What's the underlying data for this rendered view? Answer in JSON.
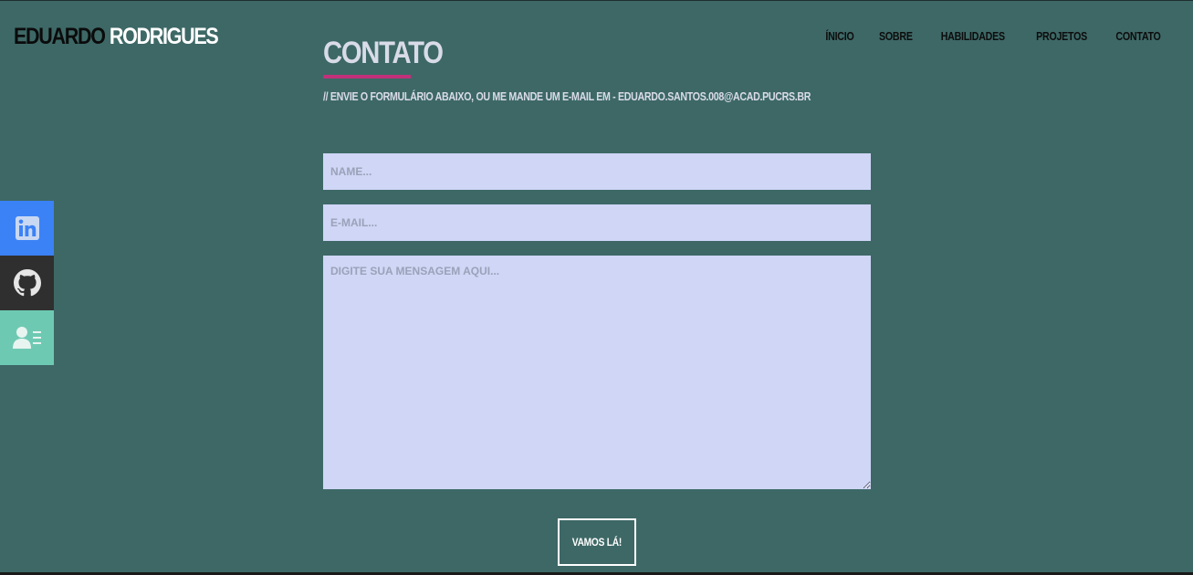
{
  "brand": {
    "first_name": "EDUARDO",
    "last_name": "RODRIGUES"
  },
  "nav": {
    "items": [
      {
        "label": "ÍNICIO"
      },
      {
        "label": "SOBRE"
      },
      {
        "label": "HABILIDADES"
      },
      {
        "label": "PROJETOS"
      },
      {
        "label": "CONTATO"
      }
    ]
  },
  "social": {
    "linkedin": {
      "icon": "linkedin-icon",
      "color": "#3b82f6"
    },
    "github": {
      "icon": "github-icon",
      "color": "#2f2f2f"
    },
    "resume": {
      "icon": "resume-icon",
      "color": "#6ec9b2"
    }
  },
  "contact": {
    "title": "CONTATO",
    "subtitle": "// ENVIE O FORMULÁRIO ABAIXO, OU ME MANDE UM E-MAIL EM - EDUARDO.SANTOS.008@ACAD.PUCRS.BR",
    "name_placeholder": "NAME...",
    "email_placeholder": "E-MAIL...",
    "message_placeholder": "DIGITE SUA MENSAGEM AQUI...",
    "submit_label": "VAMOS LÁ!"
  },
  "colors": {
    "background": "#3d6866",
    "accent": "#c2307a",
    "input_bg": "#cfd6f6"
  }
}
